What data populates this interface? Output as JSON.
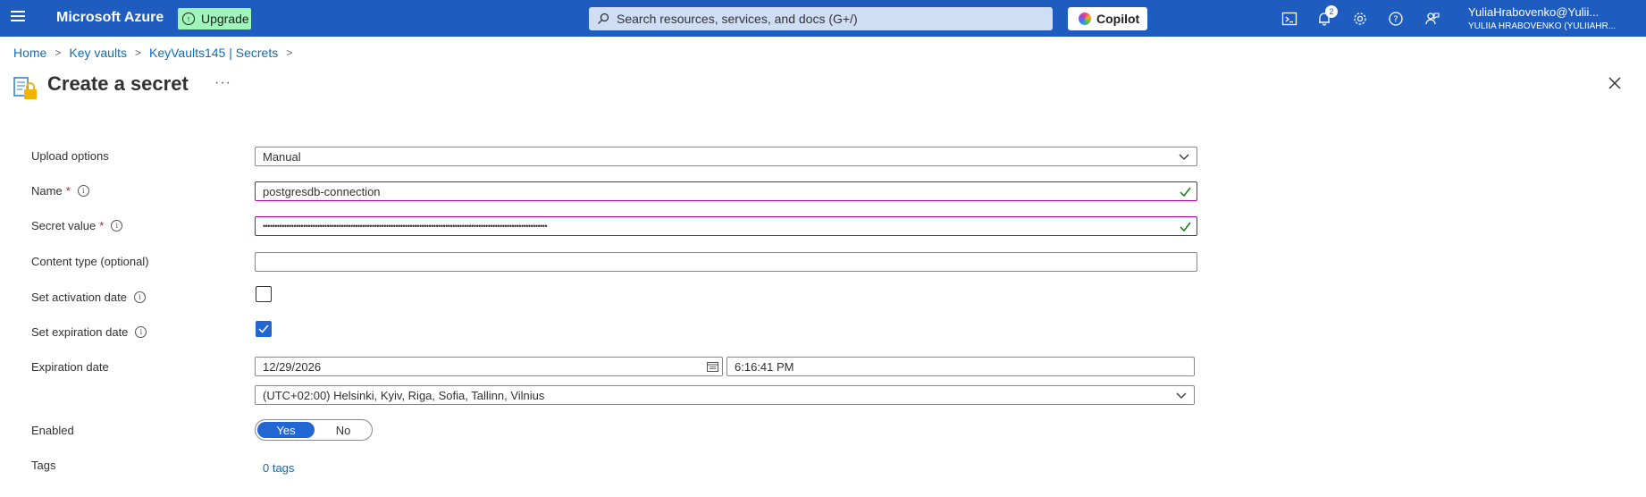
{
  "topbar": {
    "brand": "Microsoft Azure",
    "upgrade_label": "Upgrade",
    "search_placeholder": "Search resources, services, and docs (G+/)",
    "copilot_label": "Copilot",
    "notification_count": "2",
    "user_name": "YuliaHrabovenko@Yulii...",
    "user_directory": "YULIIA HRABOVENKO (YULIIAHR..."
  },
  "breadcrumb": [
    "Home",
    "Key vaults",
    "KeyVaults145 | Secrets"
  ],
  "page": {
    "title": "Create a secret",
    "more_label": "···"
  },
  "form": {
    "upload_options": {
      "label": "Upload options",
      "value": "Manual"
    },
    "name": {
      "label": "Name",
      "required_mark": "*",
      "value": "postgresdb-connection"
    },
    "secret_value": {
      "label": "Secret value",
      "required_mark": "*",
      "value": "••••••••••••••••••••••••••••••••••••••••••••••••••••••••••••••••••••••••••••••••••••••••••••••••••••••••••••••••••••••••"
    },
    "content_type": {
      "label": "Content type (optional)",
      "value": ""
    },
    "activation_date": {
      "label": "Set activation date",
      "checked": false
    },
    "expiration_date_toggle": {
      "label": "Set expiration date",
      "checked": true
    },
    "expiration_date": {
      "label": "Expiration date",
      "date": "12/29/2026",
      "time": "6:16:41 PM",
      "timezone": "(UTC+02:00) Helsinki, Kyiv, Riga, Sofia, Tallinn, Vilnius"
    },
    "enabled": {
      "label": "Enabled",
      "yes": "Yes",
      "no": "No",
      "selected": "Yes"
    },
    "tags": {
      "label": "Tags",
      "link": "0 tags"
    }
  },
  "colors": {
    "topbar_bg": "#1f5cc0",
    "accent": "#2266d4",
    "link": "#0f6cbd",
    "valid_border": "#b4009e",
    "valid_check": "#107c10"
  }
}
